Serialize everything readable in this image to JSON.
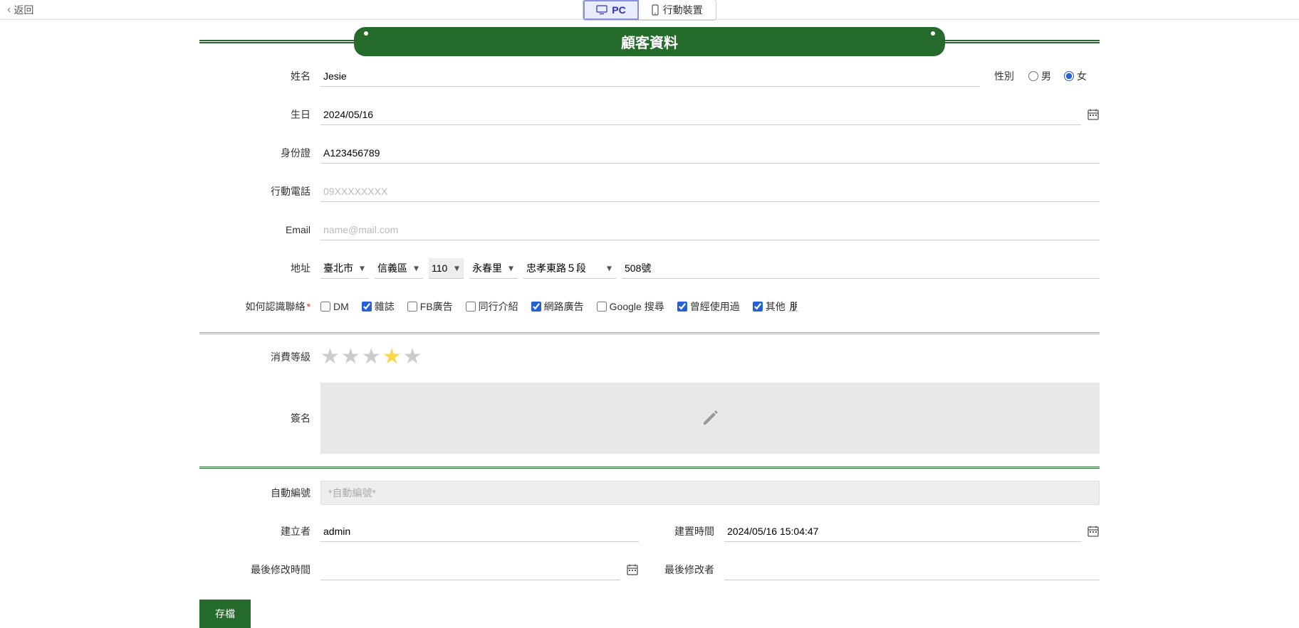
{
  "topbar": {
    "back": "返回",
    "pc": "PC",
    "mobile": "行動裝置"
  },
  "header": {
    "title": "顧客資料"
  },
  "labels": {
    "name": "姓名",
    "gender": "性別",
    "male": "男",
    "female": "女",
    "birthday": "生日",
    "idno": "身份證",
    "mobile": "行動電話",
    "email": "Email",
    "address": "地址",
    "howknow": "如何認識聯絡",
    "level": "消費等級",
    "signature": "簽名",
    "autono": "自動編號",
    "creator": "建立者",
    "createtime": "建置時間",
    "lastmodtime": "最後修改時間",
    "lastmodby": "最後修改者",
    "save": "存檔"
  },
  "placeholders": {
    "mobile": "09XXXXXXXX",
    "email": "name@mail.com",
    "autono": "*自動編號*"
  },
  "values": {
    "name": "Jesie",
    "gender": "female",
    "birthday": "2024/05/16",
    "idno": "A123456789",
    "mobile": "",
    "email": "",
    "addr_city": "臺北市",
    "addr_dist": "信義區",
    "addr_zip": "110",
    "addr_vill": "永春里",
    "addr_road": "忠孝東路５段",
    "addr_no": "508號",
    "other_text": "朋友使用過",
    "autono": "",
    "creator": "admin",
    "createtime": "2024/05/16 15:04:47",
    "lastmodtime": "",
    "lastmodby": ""
  },
  "howknow_options": [
    {
      "label": "DM",
      "checked": false
    },
    {
      "label": "雜誌",
      "checked": true
    },
    {
      "label": "FB廣告",
      "checked": false
    },
    {
      "label": "同行介紹",
      "checked": false
    },
    {
      "label": "網路廣告",
      "checked": true
    },
    {
      "label": "Google 搜尋",
      "checked": false
    },
    {
      "label": "曾經使用過",
      "checked": true
    },
    {
      "label": "其他",
      "checked": true
    }
  ],
  "rating_hover": 4
}
